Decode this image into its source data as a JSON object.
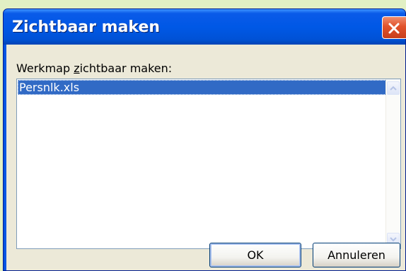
{
  "dialog": {
    "title": "Zichtbaar maken",
    "label": "Werkmap zichtbaar maken:",
    "label_prefix": "Werkmap ",
    "label_mnemonic": "z",
    "label_suffix": "ichtbaar maken:",
    "workbooks": [
      {
        "name": "Persnlk.xls",
        "selected": true
      }
    ],
    "ok_label": "OK",
    "cancel_label": "Annuleren"
  },
  "colors": {
    "titlebar": "#0054e3",
    "selection": "#316ac5",
    "close_button": "#e1522b",
    "dialog_face": "#ece9d8",
    "desktop": "#e2f0c4"
  },
  "icons": {
    "close": "close-icon",
    "scroll_up": "chevron-up-icon",
    "scroll_down": "chevron-down-icon"
  }
}
